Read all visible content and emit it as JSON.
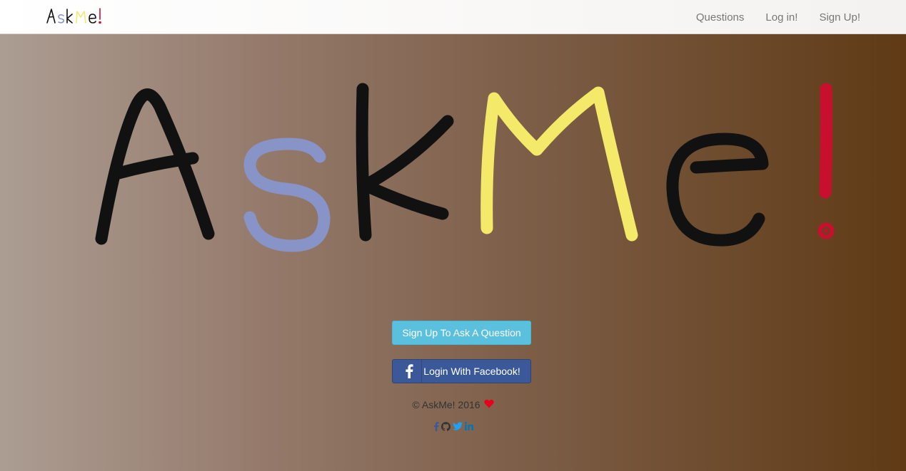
{
  "navbar": {
    "brand": "AskMe!",
    "links": [
      {
        "label": "Questions"
      },
      {
        "label": "Log in!"
      },
      {
        "label": "Sign Up!"
      }
    ]
  },
  "hero": {
    "logo_text": "AskMe!"
  },
  "buttons": {
    "signup_label": "Sign Up To Ask A Question",
    "facebook_label": "Login With Facebook!"
  },
  "footer": {
    "copyright": "© AskMe! 2016",
    "heart_icon": "heart-icon",
    "social_icons": [
      "facebook-icon",
      "github-icon",
      "twitter-icon",
      "linkedin-icon"
    ]
  },
  "colors": {
    "letter_dark": "#111111",
    "letter_blue": "#8893c8",
    "letter_yellow": "#f5e96a",
    "letter_red": "#c8102e",
    "signup_button": "#5bc0de",
    "facebook_button": "#3b5998",
    "heart": "#e8001c"
  }
}
